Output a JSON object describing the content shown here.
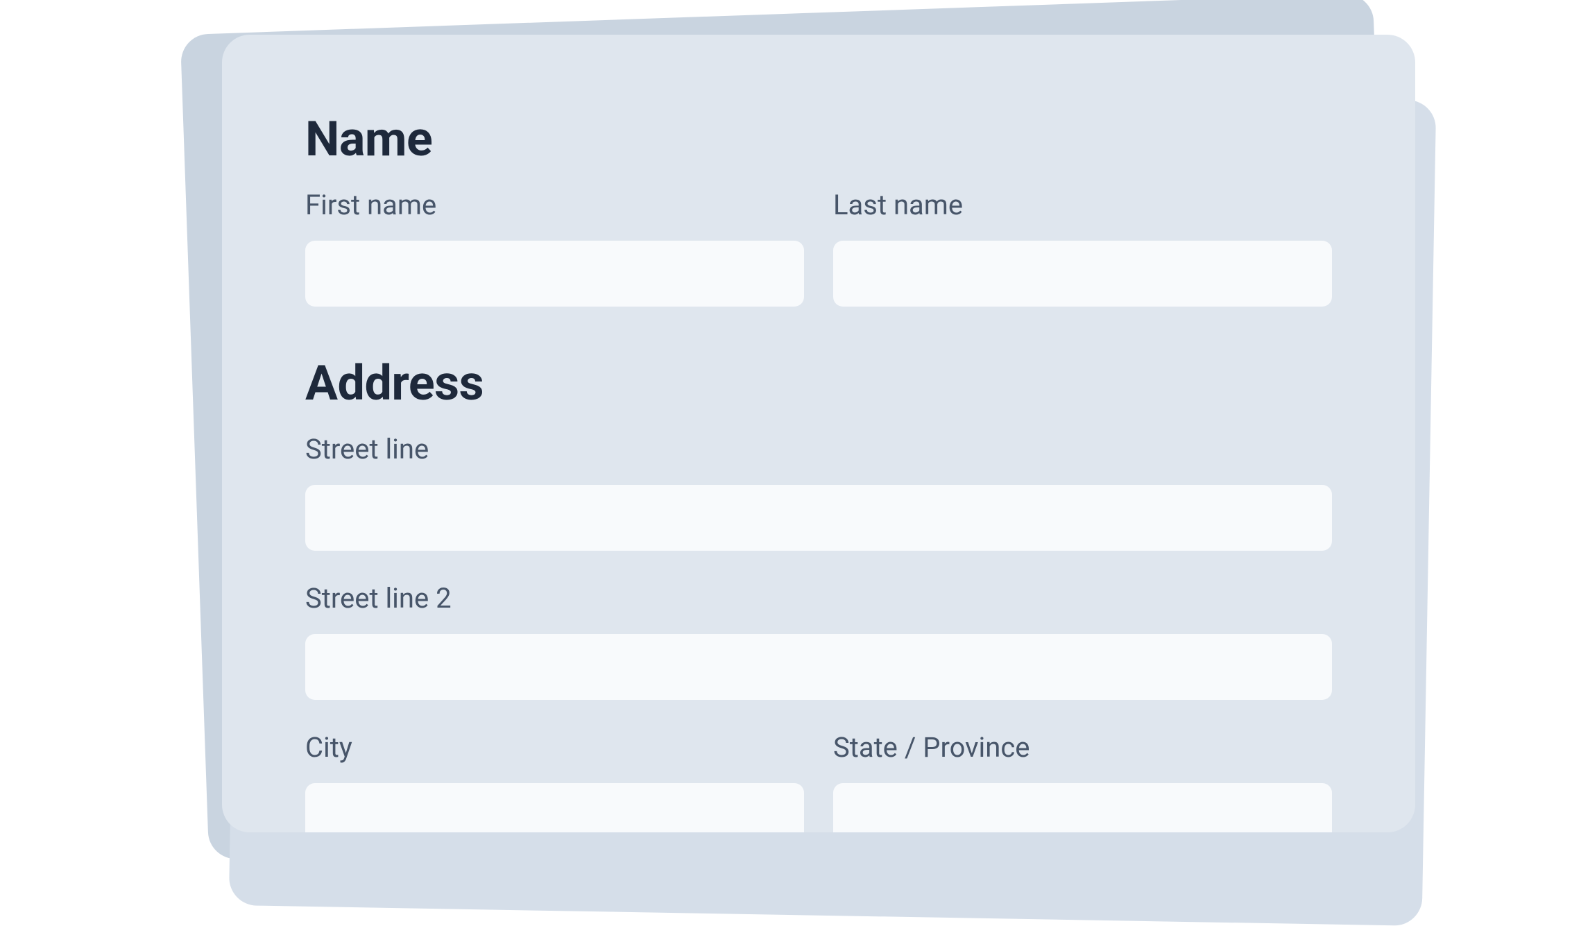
{
  "sections": {
    "name": {
      "heading": "Name",
      "first_name_label": "First name",
      "first_name_value": "",
      "last_name_label": "Last name",
      "last_name_value": ""
    },
    "address": {
      "heading": "Address",
      "street_line_label": "Street line",
      "street_line_value": "",
      "street_line_2_label": "Street line 2",
      "street_line_2_value": "",
      "city_label": "City",
      "city_value": "",
      "state_label": "State / Province",
      "state_value": ""
    }
  },
  "colors": {
    "card_bg": "#dfe6ee",
    "card_back_1": "#c9d4e0",
    "card_back_2": "#d5dee9",
    "input_bg": "#f8fafc",
    "heading_color": "#1e293b",
    "label_color": "#475569"
  }
}
